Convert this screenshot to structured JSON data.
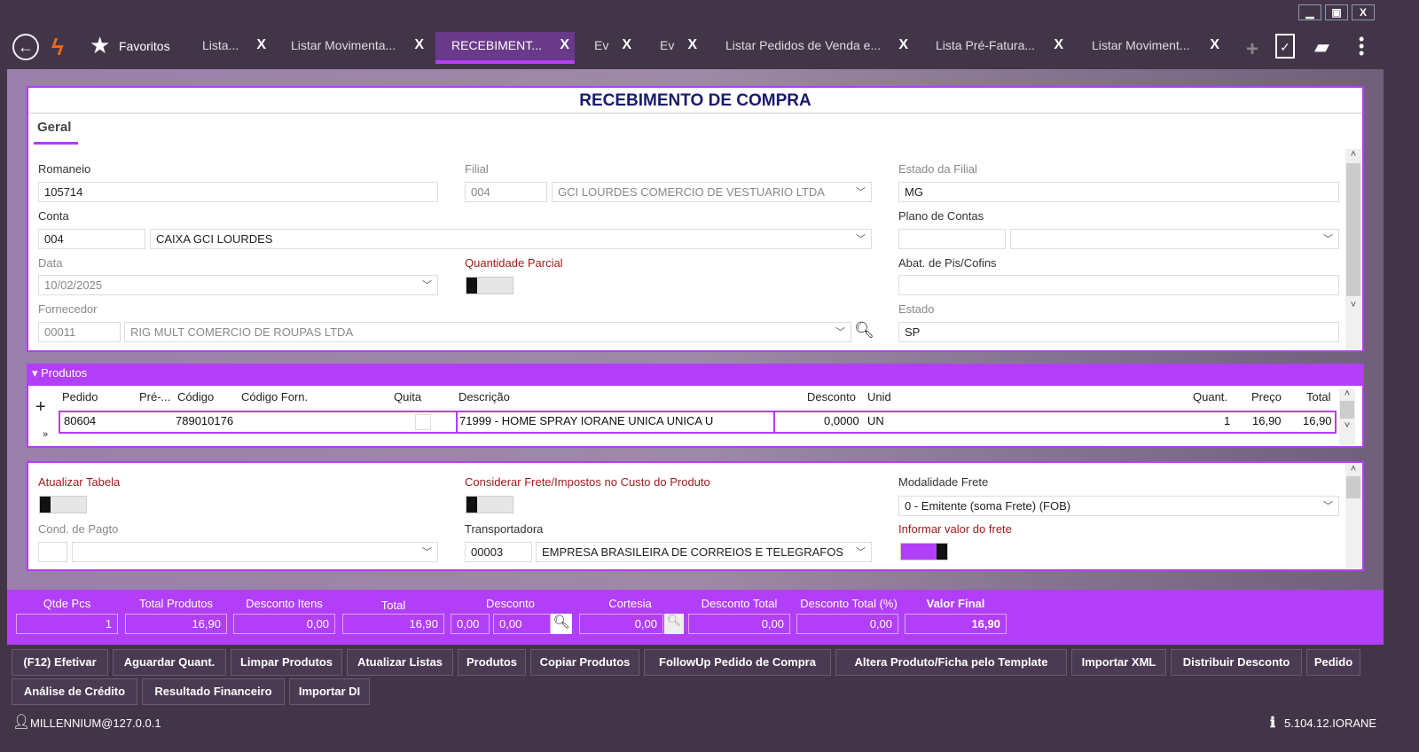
{
  "window": {
    "minimize": "▁",
    "maximize": "▣",
    "close": "X"
  },
  "nav": {
    "favorites": "Favoritos"
  },
  "tabs": [
    {
      "label": "Lista..."
    },
    {
      "label": "Listar Movimenta..."
    },
    {
      "label": "RECEBIMENT..."
    },
    {
      "label": "Ev"
    },
    {
      "label": "Ev"
    },
    {
      "label": "Listar Pedidos de Venda e..."
    },
    {
      "label": "Lista Pré-Fatura..."
    },
    {
      "label": "Listar Moviment..."
    }
  ],
  "form": {
    "title": "RECEBIMENTO DE COMPRA",
    "tab": "Geral",
    "romaneio_label": "Romaneio",
    "romaneio": "105714",
    "filial_label": "Filial",
    "filial_code": "004",
    "filial_name": "GCI LOURDES COMERCIO DE VESTUARIO LTDA",
    "estado_filial_label": "Estado da Filial",
    "estado_filial": "MG",
    "conta_label": "Conta",
    "conta_code": "004",
    "conta_name": "CAIXA GCI LOURDES",
    "plano_label": "Plano de Contas",
    "data_label": "Data",
    "data": "10/02/2025",
    "qtd_parcial_label": "Quantidade Parcial",
    "abat_label": "Abat. de Pis/Cofins",
    "fornecedor_label": "Fornecedor",
    "fornecedor_code": "00011",
    "fornecedor_name": "RIG MULT COMERCIO DE ROUPAS LTDA",
    "estado_label": "Estado",
    "estado": "SP"
  },
  "produtos": {
    "title": "Produtos",
    "columns": [
      "Pedido",
      "Pré-...",
      "Código",
      "Código Forn.",
      "Quita",
      "Descrição",
      "Desconto",
      "Unid",
      "Quant.",
      "Preço",
      "Total"
    ],
    "rows": [
      {
        "pedido": "80604",
        "pre": "",
        "codigo": "789010176",
        "codigo_forn": "",
        "descricao": "71999 - HOME SPRAY IORANE  UNICA  UNICA  U",
        "desconto": "0,0000",
        "unid": "UN",
        "quant": "1",
        "preco": "16,90",
        "total": "16,90"
      }
    ]
  },
  "extra": {
    "atualizar_label": "Atualizar Tabela",
    "considerar_label": "Considerar Frete/Impostos no Custo do Produto",
    "modalidade_label": "Modalidade Frete",
    "modalidade": "0 - Emitente (soma Frete) (FOB)",
    "cond_label": "Cond. de Pagto",
    "transp_label": "Transportadora",
    "transp_code": "00003",
    "transp_name": "EMPRESA BRASILEIRA DE CORREIOS E TELEGRAFOS",
    "informar_label": "Informar valor do frete"
  },
  "totals": {
    "qtde_label": "Qtde Pcs",
    "qtde": "1",
    "total_prod_label": "Total Produtos",
    "total_prod": "16,90",
    "desc_itens_label": "Desconto Itens",
    "desc_itens": "0,00",
    "total_label": "Total",
    "total": "16,90",
    "desconto_label": "Desconto",
    "desconto_pct": "0,00",
    "desconto": "0,00",
    "cortesia_label": "Cortesia",
    "cortesia": "0,00",
    "desc_total_label": "Desconto Total",
    "desc_total": "0,00",
    "desc_total_pct_label": "Desconto Total (%)",
    "desc_total_pct": "0,00",
    "valor_final_label": "Valor Final",
    "valor_final": "16,90"
  },
  "buttons": [
    "(F12) Efetivar",
    "Aguardar Quant.",
    "Limpar Produtos",
    "Atualizar Listas",
    "Produtos",
    "Copiar Produtos",
    "FollowUp Pedido de Compra",
    "Altera Produto/Ficha pelo Template",
    "Importar XML",
    "Distribuir Desconto",
    "Pedido",
    "Análise de Crédito",
    "Resultado Financeiro",
    "Importar DI"
  ],
  "status": {
    "user": "MILLENNIUM@127.0.0.1",
    "version": "5.104.12.IORANE"
  }
}
